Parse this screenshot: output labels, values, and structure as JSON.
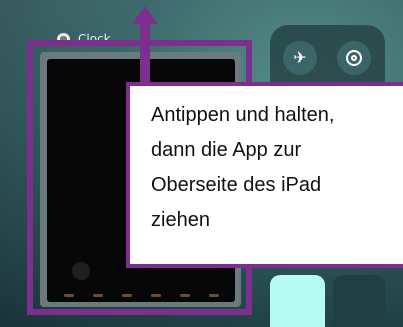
{
  "app_switcher": {
    "app_name": "Clock"
  },
  "control_center": {
    "airplane_icon": "airplane-icon",
    "airdrop_icon": "airdrop-icon",
    "accent_color": "#b6fbf2"
  },
  "callout": {
    "lines": [
      "Antippen und halten,",
      "dann die App zur",
      "Oberseite des iPad",
      "ziehen"
    ],
    "border_color": "#7d2f8f"
  },
  "arrow": {
    "direction": "up",
    "color": "#7d2f8f"
  }
}
